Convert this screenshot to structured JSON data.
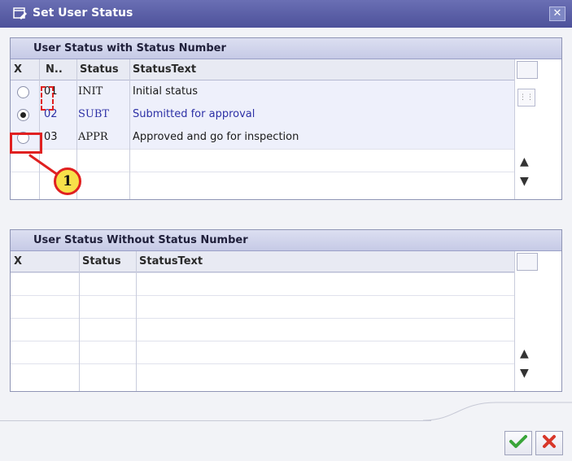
{
  "window": {
    "title": "Set User Status",
    "icon": "set-status-icon",
    "close_icon": "close-icon"
  },
  "panel_with_number": {
    "title": "User Status with Status Number",
    "columns": [
      "X",
      "N..",
      "Status",
      "StatusText"
    ],
    "rows": [
      {
        "selected": false,
        "number": "01",
        "status": "INIT",
        "text": "Initial status"
      },
      {
        "selected": true,
        "number": "02",
        "status": "SUBT",
        "text": "Submitted for approval"
      },
      {
        "selected": false,
        "number": "03",
        "status": "APPR",
        "text": "Approved and go for inspection"
      }
    ]
  },
  "panel_without_number": {
    "title": "User Status Without Status Number",
    "columns": [
      "X",
      "Status",
      "StatusText"
    ],
    "rows": []
  },
  "annotation": {
    "callout_number": "1"
  },
  "buttons": {
    "confirm_icon": "checkmark-icon",
    "cancel_icon": "cancel-x-icon"
  },
  "colors": {
    "title_bar": "#4d519a",
    "selected_text": "#2d31a6",
    "annotation_red": "#e02020",
    "callout_yellow": "#f7e04a",
    "confirm_green": "#3aa53a",
    "cancel_red": "#d8372a"
  }
}
